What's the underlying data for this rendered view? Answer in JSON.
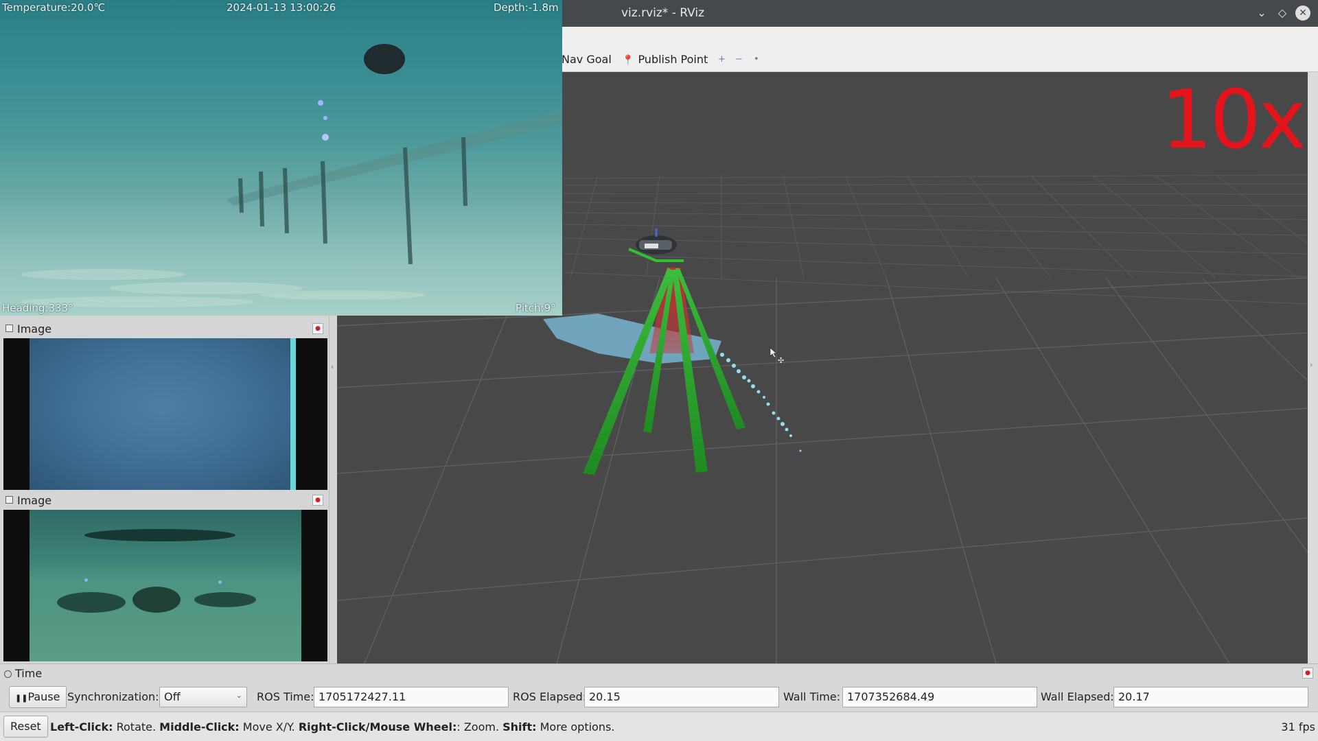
{
  "window": {
    "title": "viz.rviz* - RViz"
  },
  "toolbar": {
    "nav_goal_label": "Nav Goal",
    "publish_point_label": "Publish Point",
    "extra_tools": [
      "+",
      "−",
      "•"
    ]
  },
  "viewport": {
    "speed_label": "10x"
  },
  "camera_osd": {
    "temperature": "Temperature:20.0℃",
    "datetime": "2024-01-13 13:00:26",
    "depth": "Depth:-1.8m",
    "heading": "Heading:333°",
    "pitch": "Pitch:9°"
  },
  "image_panels": [
    {
      "title": "Image"
    },
    {
      "title": "Image"
    }
  ],
  "time_panel": {
    "title": "Time",
    "pause_label": "Pause",
    "sync_label": "Synchronization:",
    "sync_value": "Off",
    "ros_time_label": "ROS Time:",
    "ros_time_value": "1705172427.11",
    "ros_elapsed_label": "ROS Elapsed:",
    "ros_elapsed_value": "20.15",
    "wall_time_label": "Wall Time:",
    "wall_time_value": "1707352684.49",
    "wall_elapsed_label": "Wall Elapsed:",
    "wall_elapsed_value": "20.17"
  },
  "status_bar": {
    "reset_label": "Reset",
    "help_left_click": "Left-Click:",
    "help_rotate": " Rotate. ",
    "help_middle_click": "Middle-Click:",
    "help_move": " Move X/Y. ",
    "help_right_click": "Right-Click/Mouse Wheel:",
    "help_zoom": ": Zoom. ",
    "help_shift": "Shift:",
    "help_more": " More options.",
    "fps": "31 fps"
  },
  "colors": {
    "speed_label": "#e4141c",
    "sonar_beam": "#2fa82f",
    "sonar_cloud": "#7ec4e4",
    "grid_background": "#484848"
  }
}
